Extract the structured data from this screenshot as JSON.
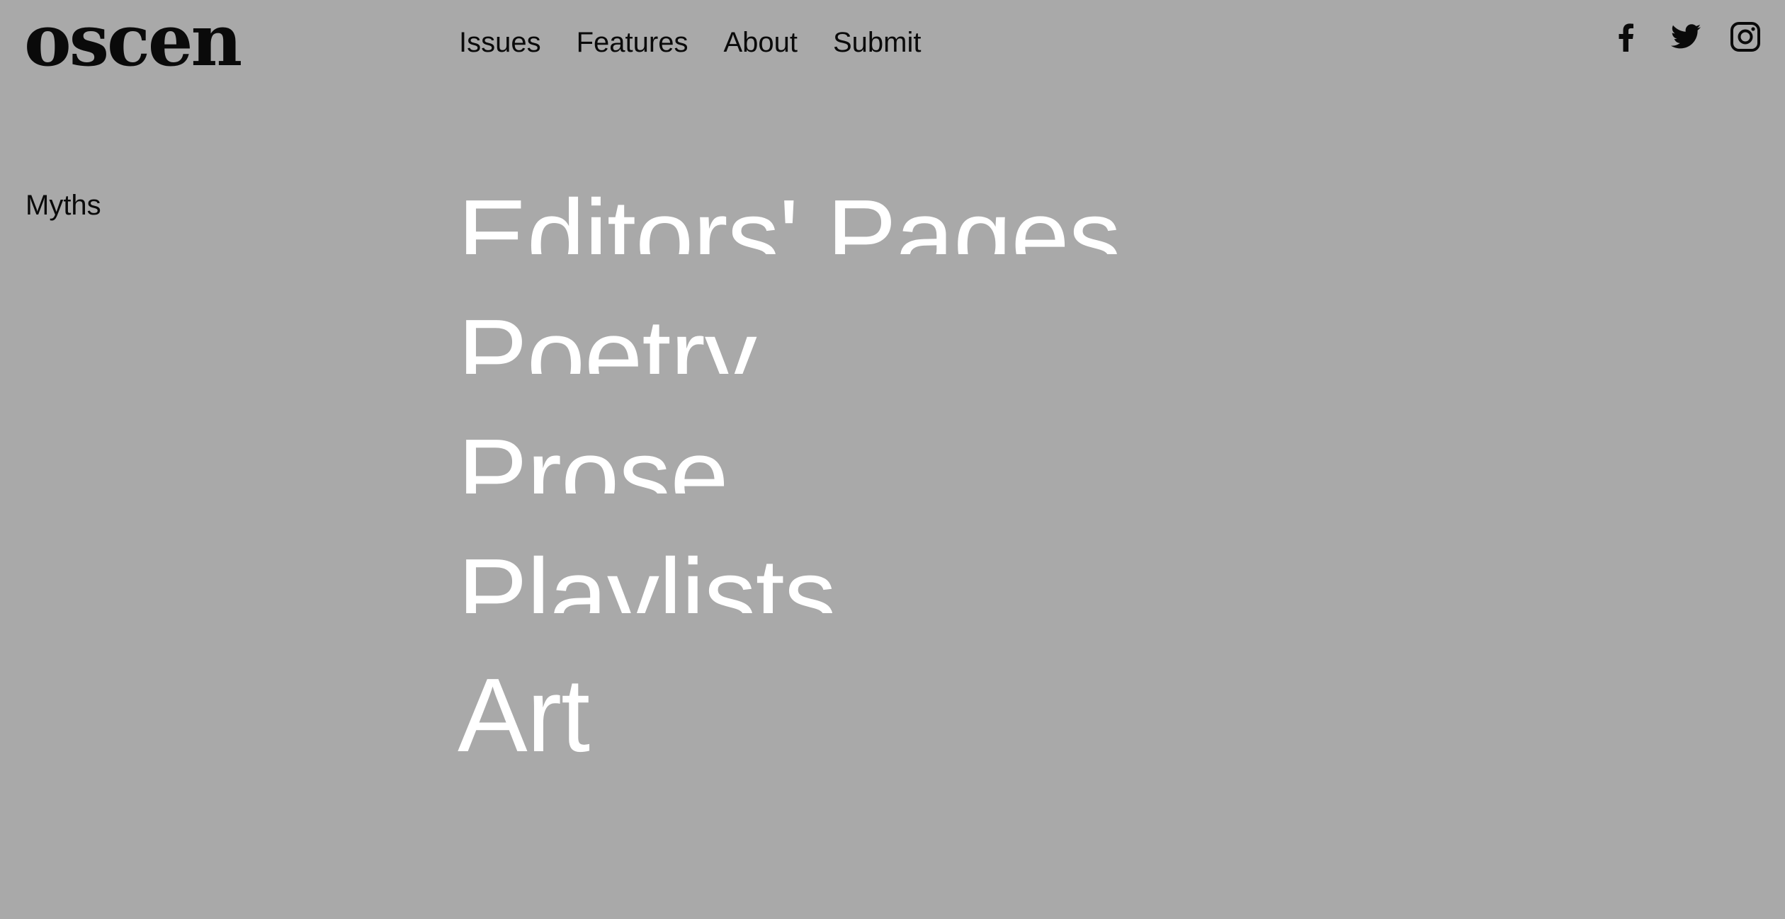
{
  "site": {
    "logo": "oscen"
  },
  "nav": {
    "items": [
      {
        "label": "Issues"
      },
      {
        "label": "Features"
      },
      {
        "label": "About"
      },
      {
        "label": "Submit"
      }
    ]
  },
  "social": {
    "icons": [
      "facebook-icon",
      "twitter-icon",
      "instagram-icon"
    ]
  },
  "issue": {
    "title": "Myths"
  },
  "sections": {
    "items": [
      {
        "label": "Editors' Pages"
      },
      {
        "label": "Poetry"
      },
      {
        "label": "Prose"
      },
      {
        "label": "Playlists"
      },
      {
        "label": "Art"
      }
    ]
  },
  "colors": {
    "background": "#a9a9a9",
    "text": "#0a0a0a",
    "section_text": "#ffffff"
  }
}
